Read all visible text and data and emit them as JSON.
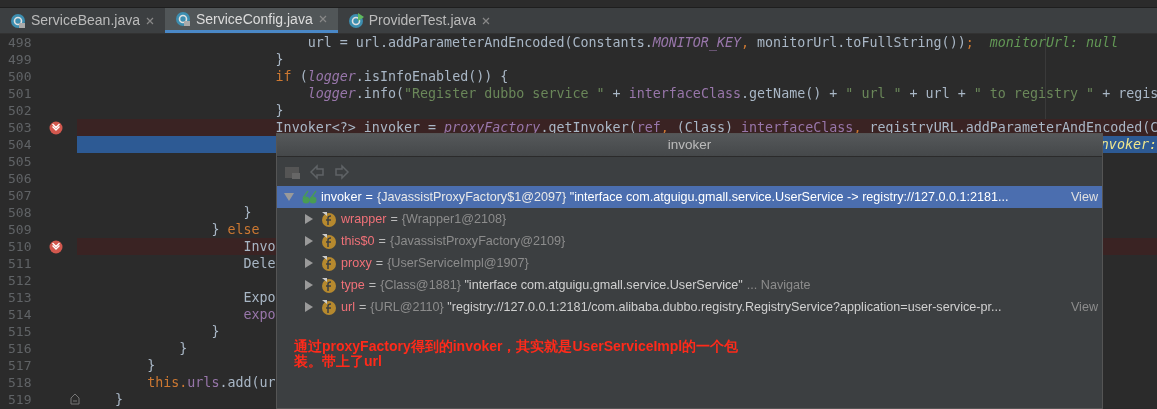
{
  "tabs": [
    {
      "label": "ServiceBean.java",
      "kind": "locked-class",
      "selected": false
    },
    {
      "label": "ServiceConfig.java",
      "kind": "locked-class",
      "selected": true
    },
    {
      "label": "ProviderTest.java",
      "kind": "runnable-class",
      "selected": false
    }
  ],
  "code_lines": [
    {
      "number": "498",
      "breakpoint": false,
      "current": false,
      "tokens": [
        {
          "text": "                            url = url.addParameterAndEncoded(Constants.",
          "kind": "plain"
        },
        {
          "text": "MONITOR_KEY",
          "kind": "static"
        },
        {
          "text": ", ",
          "kind": "keyword"
        },
        {
          "text": "monitorUrl.toFullString())",
          "kind": "plain"
        },
        {
          "text": ";",
          "kind": "keyword"
        },
        {
          "text": "  monitorUrl: null",
          "kind": "debug"
        }
      ]
    },
    {
      "number": "499",
      "breakpoint": false,
      "current": false,
      "tokens": [
        {
          "text": "                        }",
          "kind": "plain"
        }
      ]
    },
    {
      "number": "500",
      "breakpoint": false,
      "current": false,
      "tokens": [
        {
          "text": "                        if ",
          "kind": "keyword"
        },
        {
          "text": "(",
          "kind": "plain"
        },
        {
          "text": "logger",
          "kind": "static"
        },
        {
          "text": ".isInfoEnabled()) {",
          "kind": "plain"
        }
      ]
    },
    {
      "number": "501",
      "breakpoint": false,
      "current": false,
      "tokens": [
        {
          "text": "                            logger",
          "kind": "static"
        },
        {
          "text": ".info(",
          "kind": "plain"
        },
        {
          "text": "\"Register dubbo service \"",
          "kind": "string"
        },
        {
          "text": " + ",
          "kind": "plain"
        },
        {
          "text": "interfaceClass",
          "kind": "field"
        },
        {
          "text": ".getName() + ",
          "kind": "plain"
        },
        {
          "text": "\" url \"",
          "kind": "string"
        },
        {
          "text": " + url + ",
          "kind": "plain"
        },
        {
          "text": "\" to registry \"",
          "kind": "string"
        },
        {
          "text": " + regis",
          "kind": "plain"
        }
      ]
    },
    {
      "number": "502",
      "breakpoint": false,
      "current": false,
      "tokens": [
        {
          "text": "                        }",
          "kind": "plain"
        }
      ]
    },
    {
      "number": "503",
      "breakpoint": true,
      "current": false,
      "tokens": [
        {
          "text": "                        Invoker<?> invoker = ",
          "kind": "plain"
        },
        {
          "text": "proxyFactory",
          "kind": "static"
        },
        {
          "text": ".getInvoker(",
          "kind": "plain"
        },
        {
          "text": "ref",
          "kind": "field"
        },
        {
          "text": ", ",
          "kind": "keyword"
        },
        {
          "text": "(Class) ",
          "kind": "plain"
        },
        {
          "text": "interfaceClass",
          "kind": "field"
        },
        {
          "text": ", ",
          "kind": "keyword"
        },
        {
          "text": "registryURL.addParameterAndEncoded(C",
          "kind": "plain"
        }
      ]
    },
    {
      "number": "504",
      "breakpoint": false,
      "current": true,
      "inline_value": "nvoker:"
    },
    {
      "number": "505",
      "breakpoint": false,
      "current": false
    },
    {
      "number": "506",
      "breakpoint": false,
      "current": false
    },
    {
      "number": "507",
      "breakpoint": false,
      "current": false
    },
    {
      "number": "508",
      "breakpoint": false,
      "current": false,
      "tokens": [
        {
          "text": "                    }",
          "kind": "plain"
        }
      ]
    },
    {
      "number": "509",
      "breakpoint": false,
      "current": false,
      "tokens": [
        {
          "text": "                } ",
          "kind": "plain"
        },
        {
          "text": "else",
          "kind": "keyword"
        }
      ]
    },
    {
      "number": "510",
      "breakpoint": true,
      "current": false,
      "tokens": [
        {
          "text": "                    Invo",
          "kind": "plain"
        }
      ]
    },
    {
      "number": "511",
      "breakpoint": false,
      "current": false,
      "tokens": [
        {
          "text": "                    Dele",
          "kind": "plain"
        }
      ]
    },
    {
      "number": "512",
      "breakpoint": false,
      "current": false
    },
    {
      "number": "513",
      "breakpoint": false,
      "current": false,
      "tokens": [
        {
          "text": "                    Expo",
          "kind": "plain"
        }
      ]
    },
    {
      "number": "514",
      "breakpoint": false,
      "current": false,
      "tokens": [
        {
          "text": "                    expo",
          "kind": "field"
        }
      ]
    },
    {
      "number": "515",
      "breakpoint": false,
      "current": false,
      "tokens": [
        {
          "text": "                }",
          "kind": "plain"
        }
      ]
    },
    {
      "number": "516",
      "breakpoint": false,
      "current": false,
      "tokens": [
        {
          "text": "            }",
          "kind": "plain"
        }
      ]
    },
    {
      "number": "517",
      "breakpoint": false,
      "current": false,
      "tokens": [
        {
          "text": "        }",
          "kind": "plain"
        }
      ]
    },
    {
      "number": "518",
      "breakpoint": false,
      "current": false,
      "tokens": [
        {
          "text": "        this.",
          "kind": "keyword"
        },
        {
          "text": "urls",
          "kind": "field"
        },
        {
          "text": ".add(ur",
          "kind": "plain"
        }
      ]
    },
    {
      "number": "519",
      "breakpoint": false,
      "current": false,
      "folded_end": true,
      "tokens": [
        {
          "text": "    }",
          "kind": "plain"
        }
      ]
    }
  ],
  "popup": {
    "title": "invoker",
    "tree": {
      "kind": "watch",
      "name": "invoker",
      "assign": "=",
      "value": "{JavassistProxyFactory$1@2097}",
      "string": "\"interface com.atguigu.gmall.service.UserService -> registry://127.0.0.1:2181...",
      "action": "View",
      "expanded": true,
      "selected": true,
      "children": [
        {
          "kind": "field",
          "name": "wrapper",
          "assign": "=",
          "value": "{Wrapper1@2108}",
          "expanded": false,
          "selected": false
        },
        {
          "kind": "field",
          "name": "this$0",
          "assign": "=",
          "value": "{JavassistProxyFactory@2109}",
          "expanded": false,
          "selected": false
        },
        {
          "kind": "field",
          "name": "proxy",
          "assign": "=",
          "value": "{UserServiceImpl@1907}",
          "expanded": false,
          "selected": false
        },
        {
          "kind": "field",
          "name": "type",
          "assign": "=",
          "value": "{Class@1881}",
          "string": "\"interface com.atguigu.gmall.service.UserService\"",
          "action": "... Navigate",
          "expanded": false,
          "selected": false
        },
        {
          "kind": "field",
          "name": "url",
          "assign": "=",
          "value": "{URL@2110}",
          "string": "\"registry://127.0.0.1:2181/com.alibaba.dubbo.registry.RegistryService?application=user-service-pr...",
          "action": "View",
          "expanded": false,
          "selected": false
        }
      ]
    },
    "annotation": "通过proxyFactory得到的invoker，其实就是UserServiceImpl的一个包装。带上了url"
  }
}
